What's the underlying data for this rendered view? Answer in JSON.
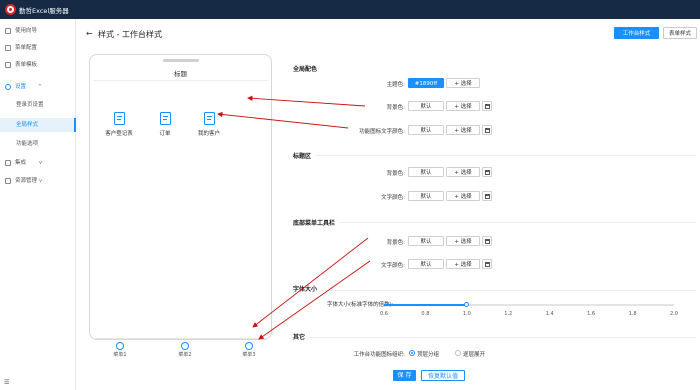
{
  "app": {
    "title": "勤哲Excel服务器"
  },
  "sidebar": {
    "items": [
      {
        "label": "使用向导",
        "chev": ""
      },
      {
        "label": "菜单配置",
        "chev": ""
      },
      {
        "label": "表单模板",
        "chev": ""
      },
      {
        "label": "设置",
        "chev": "^"
      },
      {
        "label": "登录页设置",
        "chev": ""
      },
      {
        "label": "全局样式",
        "chev": ""
      },
      {
        "label": "功能选项",
        "chev": ""
      },
      {
        "label": "集成",
        "chev": "v"
      },
      {
        "label": "资源管理",
        "chev": "v"
      }
    ]
  },
  "header": {
    "back": "←",
    "title": "样式 - 工作台样式",
    "tabs": [
      "工作台样式",
      "表单样式"
    ]
  },
  "phone": {
    "title": "标题",
    "apps": [
      "客户登记表",
      "订单",
      "我的客户"
    ],
    "footer_tabs": [
      "菜单1",
      "菜单2",
      "菜单3"
    ]
  },
  "sections": {
    "global": {
      "title": "全局配色",
      "rows": [
        {
          "label": "主题色:",
          "value": "#1890ff",
          "choose": "选择"
        },
        {
          "label": "背景色:",
          "value": "默认",
          "choose": "选择"
        },
        {
          "label": "功能图标文字颜色:",
          "value": "默认",
          "choose": "选择"
        }
      ]
    },
    "title_area": {
      "title": "标题区",
      "rows": [
        {
          "label": "背景色:",
          "value": "默认",
          "choose": "选择"
        },
        {
          "label": "文字颜色:",
          "value": "默认",
          "choose": "选择"
        }
      ]
    },
    "bottom_bar": {
      "title": "底部菜单工具栏",
      "rows": [
        {
          "label": "背景色:",
          "value": "默认",
          "choose": "选择"
        },
        {
          "label": "文字颜色:",
          "value": "默认",
          "choose": "选择"
        }
      ]
    },
    "font_size": {
      "title": "字体大小",
      "label": "字体大小(标准字体的倍数):",
      "ticks": [
        "0.6",
        "0.8",
        "1.0",
        "1.2",
        "1.4",
        "1.6",
        "1.8",
        "2.0"
      ],
      "value": 1.0,
      "min": 0.6,
      "max": 2.0
    },
    "other": {
      "title": "其它",
      "label": "工作台功能图标组织:",
      "options": [
        "顶层分组",
        "逐层展开"
      ],
      "selected": 0
    }
  },
  "actions": {
    "save": "保 存",
    "restore": "恢复默认值"
  },
  "colors": {
    "accent": "#1890ff",
    "topbar": "#162a45",
    "arrow": "#cc1111"
  }
}
